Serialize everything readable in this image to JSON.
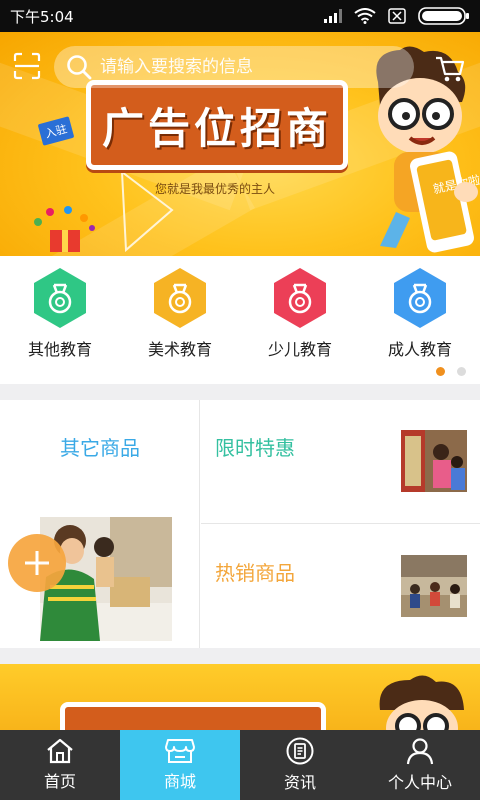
{
  "status_bar": {
    "time": "下午5:04"
  },
  "search": {
    "placeholder": "请输入要搜索的信息"
  },
  "banner": {
    "headline": "广告位招商",
    "subline": "您就是我最优秀的主人",
    "tag": "入驻",
    "phone_text": "就是你啦"
  },
  "categories": [
    {
      "label": "其他教育",
      "color": "#2fc785",
      "icon": "medal-icon"
    },
    {
      "label": "美术教育",
      "color": "#f6b324",
      "icon": "medal-icon"
    },
    {
      "label": "少儿教育",
      "color": "#ec3f57",
      "icon": "medal-icon"
    },
    {
      "label": "成人教育",
      "color": "#3f9cf0",
      "icon": "medal-icon"
    }
  ],
  "carousel": {
    "pages": 2,
    "active": 0
  },
  "products": {
    "left": {
      "title": "其它商品"
    },
    "right_top": {
      "title": "限时特惠"
    },
    "right_bottom": {
      "title": "热销商品"
    }
  },
  "tabs": [
    {
      "label": "首页",
      "icon": "home-icon",
      "active": false
    },
    {
      "label": "商城",
      "icon": "shop-icon",
      "active": true
    },
    {
      "label": "资讯",
      "icon": "news-icon",
      "active": false
    },
    {
      "label": "个人中心",
      "icon": "user-icon",
      "active": false
    }
  ],
  "colors": {
    "accent": "#3ec6ef",
    "banner": "#ffc21c",
    "fab": "#f7a63e",
    "tabbar": "#343434"
  }
}
